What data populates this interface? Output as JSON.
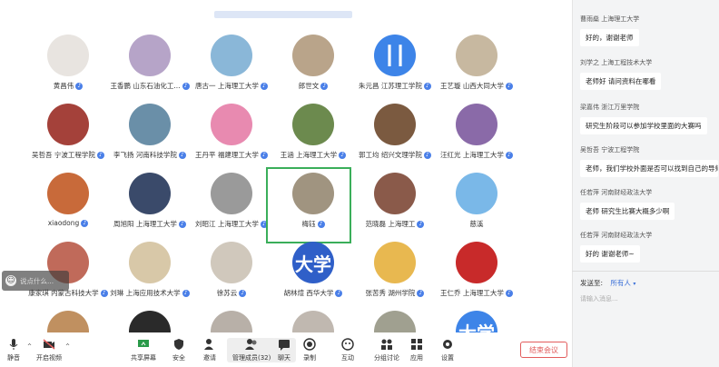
{
  "participants": [
    {
      "name": "黄昌伟",
      "color": "#e8e4e0",
      "glyph": "",
      "badge": "mic"
    },
    {
      "name": "王香鹏 山东石油化工...",
      "color": "#b6a4c8",
      "glyph": "",
      "badge": "mic"
    },
    {
      "name": "唐古一 上海理工大学",
      "color": "#8ab7d8",
      "glyph": "",
      "badge": "mic"
    },
    {
      "name": "郎世文",
      "color": "#b9a48a",
      "glyph": "",
      "badge": "mic"
    },
    {
      "name": "朱元昌 江苏理工学院",
      "color": "#3d84e8",
      "glyph": "┃┃",
      "badge": "mic"
    },
    {
      "name": "王艺璇 山西大同大学",
      "color": "#c7b8a0",
      "glyph": "",
      "badge": "mic"
    },
    {
      "name": "",
      "color": "",
      "glyph": "",
      "badge": ""
    },
    {
      "name": "吴哲吾 宁波工程学院",
      "color": "#a4413a",
      "glyph": "",
      "badge": "mic"
    },
    {
      "name": "李飞扬 河南科技学院",
      "color": "#6a8fa8",
      "glyph": "",
      "badge": "mic"
    },
    {
      "name": "王丹平 福建理工大学",
      "color": "#e88ab0",
      "glyph": "",
      "badge": "mic"
    },
    {
      "name": "王涵 上海理工大学",
      "color": "#6c8a4e",
      "glyph": "",
      "badge": "mic"
    },
    {
      "name": "郭工均 绍兴文理学院",
      "color": "#7b5a40",
      "glyph": "",
      "badge": "mic"
    },
    {
      "name": "汪红光 上海理工大学",
      "color": "#8a6aa8",
      "glyph": "",
      "badge": "mic"
    },
    {
      "name": "",
      "color": "",
      "glyph": "",
      "badge": ""
    },
    {
      "name": "xiaodong",
      "color": "#c86a3a",
      "glyph": "",
      "badge": "mic"
    },
    {
      "name": "周旭阳 上海理工大学",
      "color": "#3a4a6a",
      "glyph": "",
      "badge": "mic"
    },
    {
      "name": "刘昭江 上海理工大学",
      "color": "#9a9a9a",
      "glyph": "",
      "badge": "mic"
    },
    {
      "name": "梅钰",
      "color": "#a09480",
      "glyph": "",
      "badge": "mic",
      "selected": true
    },
    {
      "name": "范晓磊 上海理工",
      "color": "#8a5a4a",
      "glyph": "",
      "badge": "mic"
    },
    {
      "name": "慈溪",
      "color": "#7ab8e8",
      "glyph": "",
      "badge": ""
    },
    {
      "name": "",
      "color": "",
      "glyph": "",
      "badge": ""
    },
    {
      "name": "康家琪 内蒙古科技大学",
      "color": "#c06a5a",
      "glyph": "",
      "badge": "mic"
    },
    {
      "name": "刘琳 上海应用技术大学",
      "color": "#d8c8a8",
      "glyph": "",
      "badge": "mic"
    },
    {
      "name": "徐苏云",
      "color": "#d0c8bc",
      "glyph": "",
      "badge": "mic"
    },
    {
      "name": "胡林煊 西华大学",
      "color": "#2f5fc8",
      "glyph": "大学",
      "badge": "mic"
    },
    {
      "name": "张苦秀 湖州学院",
      "color": "#e8b850",
      "glyph": "",
      "badge": "mic"
    },
    {
      "name": "王仁乔 上海理工大学",
      "color": "#c82a2a",
      "glyph": "",
      "badge": "mic"
    },
    {
      "name": "",
      "color": "",
      "glyph": "",
      "badge": ""
    },
    {
      "name": "",
      "color": "#c09060",
      "glyph": "",
      "badge": ""
    },
    {
      "name": "",
      "color": "#2a2a2a",
      "glyph": "",
      "badge": ""
    },
    {
      "name": "",
      "color": "#b8b0a8",
      "glyph": "",
      "badge": ""
    },
    {
      "name": "",
      "color": "#c0b8b0",
      "glyph": "",
      "badge": ""
    },
    {
      "name": "",
      "color": "#a0a090",
      "glyph": "",
      "badge": ""
    },
    {
      "name": "",
      "color": "#3d84e8",
      "glyph": "大学",
      "badge": ""
    }
  ],
  "hint": {
    "text": "说点什么..."
  },
  "toolbar": {
    "mute": "静音",
    "video": "开启视频",
    "share": "共享屏幕",
    "security": "安全",
    "invite": "邀请",
    "members": "管理成员(32)",
    "chat": "聊天",
    "record": "录制",
    "interact": "互动",
    "breakout": "分组讨论",
    "apps": "应用",
    "settings": "设置",
    "end": "结束会议"
  },
  "chat": {
    "messages": [
      {
        "sender": "曹雨燊 上海理工大学",
        "text": "好的，谢谢老师"
      },
      {
        "sender": "刘学之 上海工程技术大学",
        "text": "老师好 请问资料在哪看"
      },
      {
        "sender": "梁嘉伟 浙江万里学院",
        "text": "研究生阶段可以参加学校里面的大赛吗"
      },
      {
        "sender": "吴哲吾 宁波工程学院",
        "text": "老师，我们学校外面是否可以找到自己的导师..."
      },
      {
        "sender": "任若萍 河南财经政法大学",
        "text": "老师 研究生比赛大概多少啊"
      },
      {
        "sender": "任若萍 河南财经政法大学",
        "text": "好的 谢谢老师~"
      }
    ],
    "send_to_label": "发送至:",
    "send_to_value": "所有人",
    "input_placeholder": "请输入消息..."
  }
}
